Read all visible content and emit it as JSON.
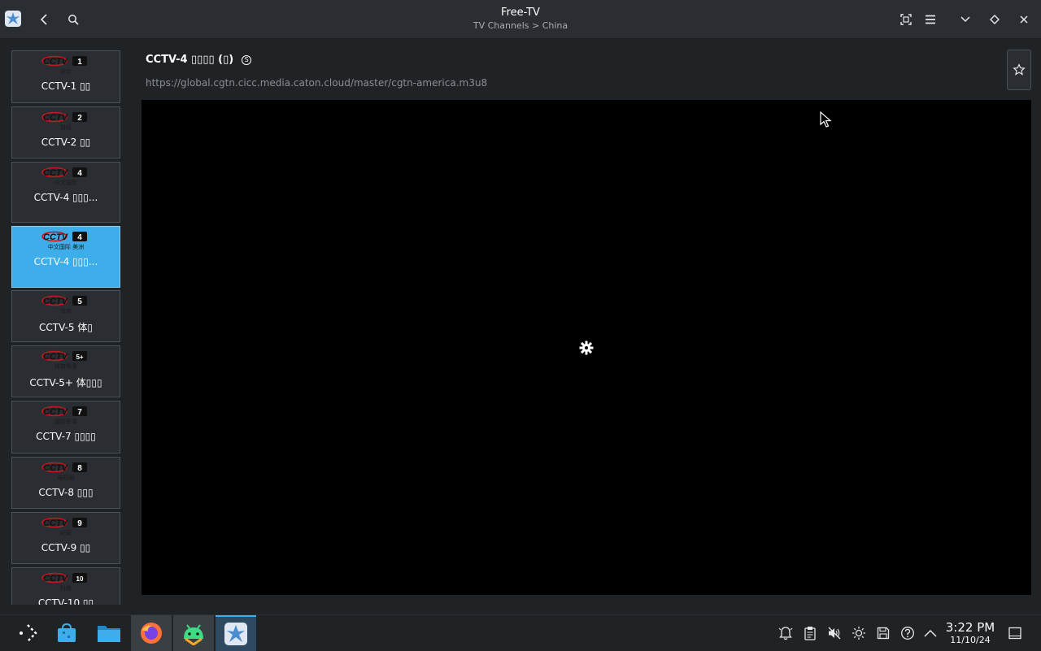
{
  "window": {
    "title": "Free-TV",
    "subtitle": "TV Channels > China"
  },
  "icons": {
    "back": "chevron-left-icon",
    "search": "search-icon",
    "fullscreen": "fullscreen-icon",
    "menu": "hamburger-menu-icon",
    "minimize": "chevron-down-icon",
    "keep_above": "diamond-icon",
    "close": "close-icon"
  },
  "channels": [
    {
      "label": "CCTV-1 ▯▯",
      "logo_num": "1",
      "logo_sub": "综合"
    },
    {
      "label": "CCTV-2 ▯▯",
      "logo_num": "2",
      "logo_sub": "财经"
    },
    {
      "label": "CCTV-4 ▯▯▯...",
      "logo_num": "4",
      "logo_sub": "中文国际"
    },
    {
      "label": "CCTV-4 ▯▯▯...",
      "logo_num": "4",
      "logo_sub": "中文国际 美洲",
      "selected": true
    },
    {
      "label": "CCTV-5 体▯",
      "logo_num": "5",
      "logo_sub": "体育"
    },
    {
      "label": "CCTV-5+ 体▯▯▯",
      "logo_num": "5+",
      "logo_sub": "体育赛事"
    },
    {
      "label": "CCTV-7 ▯▯▯▯",
      "logo_num": "7",
      "logo_sub": "国防军事"
    },
    {
      "label": "CCTV-8 ▯▯▯",
      "logo_num": "8",
      "logo_sub": "电视剧"
    },
    {
      "label": "CCTV-9 ▯▯",
      "logo_num": "9",
      "logo_sub": "纪录"
    },
    {
      "label": "CCTV-10 ▯▯",
      "logo_num": "10",
      "logo_sub": "科教"
    }
  ],
  "main": {
    "channel_title": "CCTV-4 ▯▯▯▯ (▯)",
    "badge": "S",
    "url": "https://global.cgtn.cicc.media.caton.cloud/master/cgtn-america.m3u8",
    "favorite_icon": "star-icon"
  },
  "taskbar": {
    "apps": [
      "application-launcher-icon",
      "discover-store-icon",
      "file-manager-icon",
      "firefox-icon",
      "android-icon",
      "free-tv-icon"
    ],
    "tray": [
      "notifications-icon",
      "clipboard-icon",
      "volume-muted-icon",
      "brightness-icon",
      "save-icon",
      "help-icon",
      "expand-tray-icon"
    ],
    "time": "3:22 PM",
    "date": "11/10/24"
  },
  "colors": {
    "accent": "#3daee9",
    "titlebar": "#2a2e32",
    "background": "#202326",
    "cctv_red": "#c8161e"
  }
}
